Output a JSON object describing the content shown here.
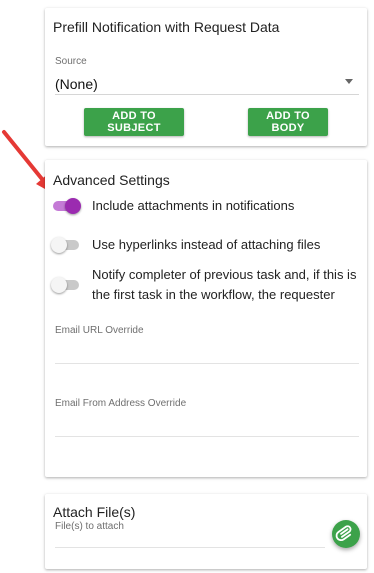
{
  "prefill": {
    "title": "Prefill Notification with Request Data",
    "source_label": "Source",
    "source_value": "(None)",
    "add_subject_label": "ADD TO SUBJECT",
    "add_body_label": "ADD TO BODY"
  },
  "advanced": {
    "title": "Advanced Settings",
    "toggles": [
      {
        "label": "Include attachments in notifications",
        "on": true
      },
      {
        "label": "Use hyperlinks instead of attaching files",
        "on": false
      },
      {
        "label": "Notify completer of previous task and, if this is the first task in the workflow, the requester",
        "on": false
      }
    ],
    "email_url_override_label": "Email URL Override",
    "email_from_override_label": "Email From Address Override"
  },
  "attach": {
    "title": "Attach File(s)",
    "files_label": "File(s) to attach"
  },
  "colors": {
    "button_green": "#3ca24a",
    "toggle_on_thumb": "#9b2bb0",
    "toggle_on_track": "#c47ad6",
    "annotation_arrow": "#e53935"
  },
  "icons": {
    "attach_button": "paperclip-icon",
    "source_dropdown": "caret-down-icon",
    "annotation": "red-arrow"
  }
}
